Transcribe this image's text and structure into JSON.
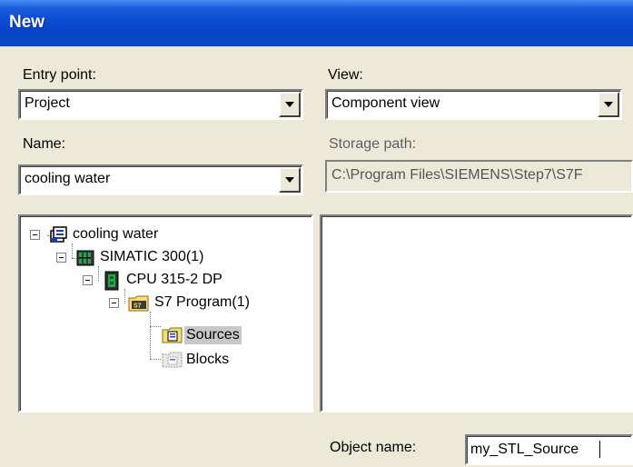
{
  "window": {
    "title": "New"
  },
  "entry_point": {
    "label": "Entry point:",
    "value": "Project"
  },
  "view": {
    "label": "View:",
    "value": "Component view"
  },
  "name": {
    "label": "Name:",
    "value": "cooling water"
  },
  "storage_path": {
    "label": "Storage path:",
    "value": "C:\\Program Files\\SIEMENS\\Step7\\S7F"
  },
  "tree": {
    "items": [
      {
        "label": "cooling water",
        "icon": "project-icon"
      },
      {
        "label": "SIMATIC 300(1)",
        "icon": "simatic-station-icon"
      },
      {
        "label": "CPU 315-2 DP",
        "icon": "cpu-icon"
      },
      {
        "label": "S7 Program(1)",
        "icon": "s7-program-folder-icon"
      },
      {
        "label": "Sources",
        "icon": "sources-folder-icon",
        "selected": true
      },
      {
        "label": "Blocks",
        "icon": "blocks-folder-icon"
      }
    ]
  },
  "object_name": {
    "label": "Object name:",
    "value": "my_STL_Source"
  },
  "colors": {
    "title_bar": "#0a4ad0",
    "selection": "#c8c8c8",
    "dialog_bg": "#ece9d8"
  }
}
